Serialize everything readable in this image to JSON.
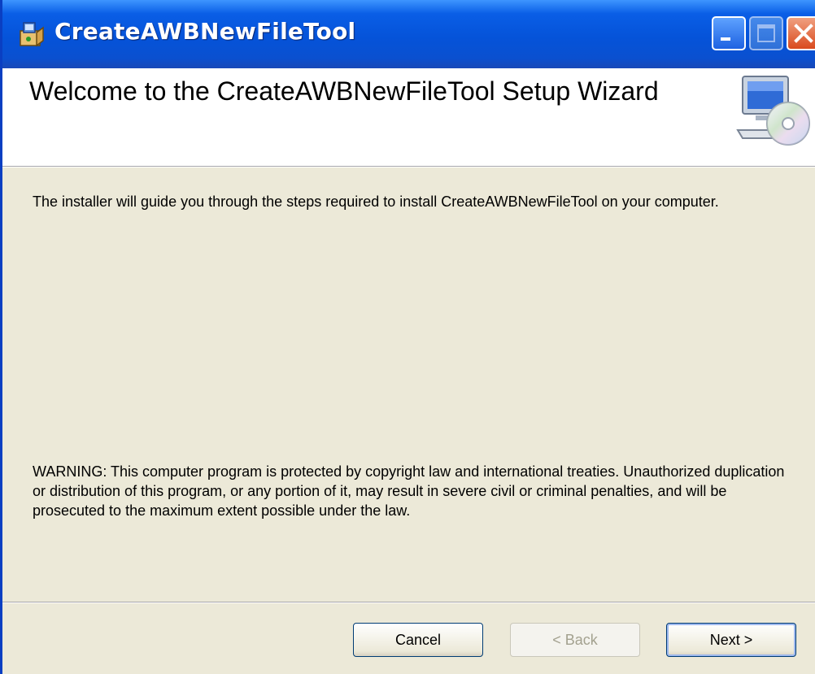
{
  "window": {
    "title": "CreateAWBNewFileTool",
    "icons": {
      "app": "installer-icon",
      "minimize": "minimize-icon",
      "maximize": "maximize-icon",
      "close": "close-icon"
    }
  },
  "header": {
    "title": "Welcome to the CreateAWBNewFileTool Setup Wizard",
    "icon": "computer-cd-icon"
  },
  "body": {
    "intro": "The installer will guide you through the steps required to install CreateAWBNewFileTool on your computer.",
    "warning": "WARNING: This computer program is protected by copyright law and international treaties. Unauthorized duplication or distribution of this program, or any portion of it, may result in severe civil or criminal penalties, and will be prosecuted to the maximum extent possible under the law."
  },
  "buttons": {
    "cancel": "Cancel",
    "back": "< Back",
    "next": "Next >"
  },
  "colors": {
    "titlebar": "#0553d9",
    "dialog_bg": "#ece9d8",
    "header_bg": "#ffffff",
    "close_button": "#d94a1e"
  }
}
